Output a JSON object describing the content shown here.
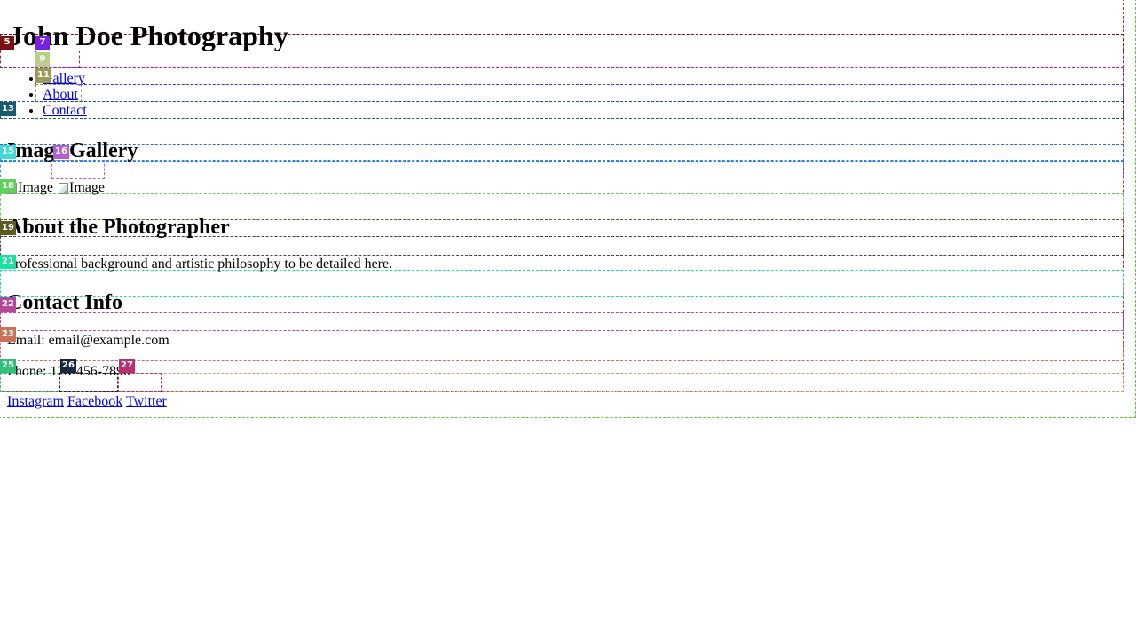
{
  "header": {
    "site_title": "John Doe Photography"
  },
  "nav": {
    "items": [
      {
        "label": "Gallery"
      },
      {
        "label": "About"
      },
      {
        "label": "Contact"
      }
    ]
  },
  "gallery": {
    "heading": "Image Gallery",
    "images": [
      {
        "alt": "Image"
      },
      {
        "alt": "Image"
      }
    ]
  },
  "about": {
    "heading": "About the Photographer",
    "body": "Professional background and artistic philosophy to be detailed here."
  },
  "contact": {
    "heading": "Contact Info",
    "email": "Email: email@example.com",
    "phone": "Phone: 123-456-7890",
    "social": [
      {
        "label": "Instagram"
      },
      {
        "label": "Facebook"
      },
      {
        "label": "Twitter"
      }
    ]
  },
  "overlay": {
    "badges": [
      "5",
      "7",
      "9",
      "11",
      "13",
      "15",
      "16",
      "18",
      "19",
      "21",
      "22",
      "23",
      "25",
      "26",
      "27"
    ],
    "colors": {
      "b5": "#7a0f12",
      "b7": "#7b1fe0",
      "b9": "#b9d08a",
      "b11": "#9a9a55",
      "b13": "#1a5a6e",
      "b15": "#3fd9d9",
      "b16": "#b45fd0",
      "b18": "#5fd05a",
      "b19": "#5a5a22",
      "b21": "#19e0a0",
      "b22": "#b8459a",
      "b23": "#c8735a",
      "b25": "#2fbf7a",
      "b26": "#142a3a",
      "b27": "#b83070"
    }
  }
}
